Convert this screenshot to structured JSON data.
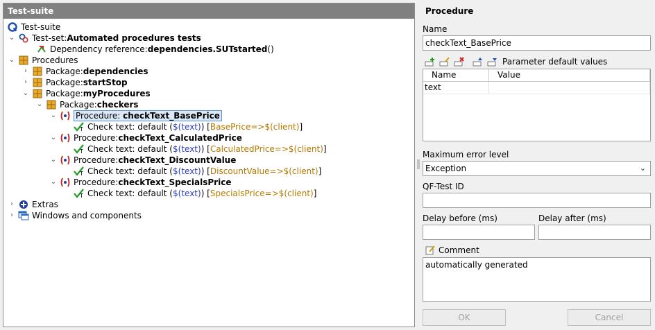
{
  "tree_panel": {
    "title": "Test-suite",
    "nodes": [
      {
        "prefix": "Test-suite",
        "name": "",
        "suffix": ""
      },
      {
        "prefix": "Test-set: ",
        "name": "Automated procedures tests",
        "suffix": ""
      },
      {
        "prefix": "Dependency reference: ",
        "name": "dependencies.SUTstarted",
        "suffix": "()"
      },
      {
        "prefix": "Procedures",
        "name": "",
        "suffix": ""
      },
      {
        "prefix": "Package: ",
        "name": "dependencies",
        "suffix": ""
      },
      {
        "prefix": "Package: ",
        "name": "startStop",
        "suffix": ""
      },
      {
        "prefix": "Package: ",
        "name": "myProcedures",
        "suffix": ""
      },
      {
        "prefix": "Package: ",
        "name": "checkers",
        "suffix": ""
      },
      {
        "prefix": "Procedure: ",
        "name": "checkText_BasePrice",
        "suffix": ""
      },
      {
        "prefix": "Check text: default (",
        "var": "$(text)",
        "mid": ") [",
        "target": "BasePrice=>$(client)",
        "end": "]"
      },
      {
        "prefix": "Procedure: ",
        "name": "checkText_CalculatedPrice",
        "suffix": ""
      },
      {
        "prefix": "Check text: default (",
        "var": "$(text)",
        "mid": ") [",
        "target": "CalculatedPrice=>$(client)",
        "end": "]"
      },
      {
        "prefix": "Procedure: ",
        "name": "checkText_DiscountValue",
        "suffix": ""
      },
      {
        "prefix": "Check text: default (",
        "var": "$(text)",
        "mid": ") [",
        "target": "DiscountValue=>$(client)",
        "end": "]"
      },
      {
        "prefix": "Procedure: ",
        "name": "checkText_SpecialsPrice",
        "suffix": ""
      },
      {
        "prefix": "Check text: default (",
        "var": "$(text)",
        "mid": ") [",
        "target": "SpecialsPrice=>$(client)",
        "end": "]"
      },
      {
        "prefix": "Extras",
        "name": "",
        "suffix": ""
      },
      {
        "prefix": "Windows and components",
        "name": "",
        "suffix": ""
      }
    ]
  },
  "detail_panel": {
    "title": "Procedure",
    "name_label": "Name",
    "name_value": "checkText_BasePrice",
    "params_label": "Parameter default values",
    "params_columns": [
      "Name",
      "Value"
    ],
    "params_rows": [
      [
        "text",
        ""
      ]
    ],
    "max_error_label": "Maximum error level",
    "max_error_value": "Exception",
    "qftest_id_label": "QF-Test ID",
    "qftest_id_value": "",
    "delay_before_label": "Delay before (ms)",
    "delay_before_value": "",
    "delay_after_label": "Delay after (ms)",
    "delay_after_value": "",
    "comment_label": "Comment",
    "comment_value": "automatically generated",
    "ok_label": "OK",
    "cancel_label": "Cancel"
  },
  "colors": {
    "header_bg": "#808080",
    "variable_blue": "#2f3dbd",
    "target_orange": "#b57a00",
    "selection_border": "#5b8fd6"
  }
}
